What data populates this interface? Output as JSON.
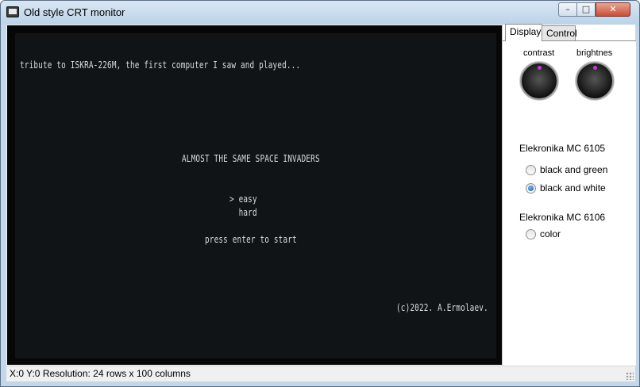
{
  "window": {
    "title": "Old style CRT monitor",
    "buttons": {
      "minimize": "–",
      "maximize": "□",
      "close": "✕"
    }
  },
  "crt": {
    "tribute": "tribute to ISKRA-226M, the first computer I saw and played...",
    "game_title": "ALMOST THE SAME SPACE INVADERS",
    "menu": [
      "> easy",
      "  hard"
    ],
    "prompt": "press enter to start",
    "copyright": "(c)2022. A.Ermolaev."
  },
  "sidebar": {
    "tabs": [
      {
        "label": "Display",
        "active": true
      },
      {
        "label": "Control",
        "active": false
      }
    ],
    "knobs": [
      {
        "label": "contrast",
        "icon": "knob-dial-icon"
      },
      {
        "label": "brightnes",
        "icon": "knob-dial-icon"
      }
    ],
    "groups": [
      {
        "label": "Elekronika MC 6105",
        "options": [
          {
            "label": "black and green",
            "checked": false
          },
          {
            "label": "black and white",
            "checked": true
          }
        ]
      },
      {
        "label": "Elekronika MC 6106",
        "options": [
          {
            "label": "color",
            "checked": false
          }
        ]
      }
    ]
  },
  "statusbar": {
    "text": "X:0 Y:0 Resolution: 24 rows x 100 columns"
  },
  "colors": {
    "crt_background": "#111416",
    "crt_text": "#d8dcde",
    "knob_indicator": "#c33bd6"
  }
}
